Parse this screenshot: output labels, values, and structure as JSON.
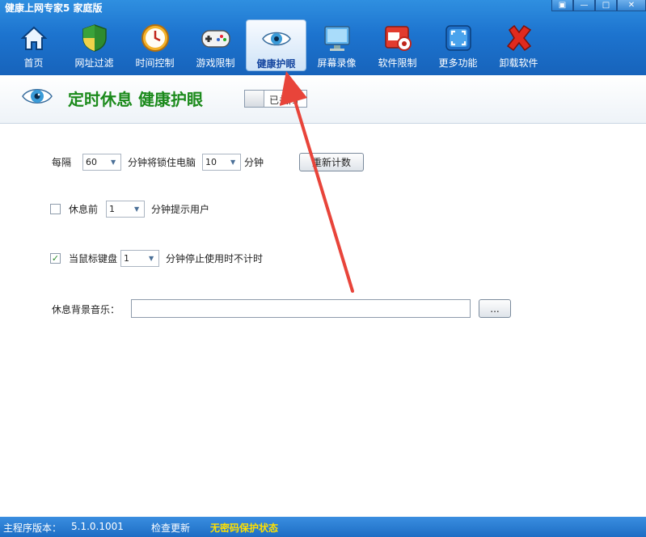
{
  "window": {
    "title": "健康上网专家5 家庭版",
    "controls": {
      "menu": "▣",
      "minimize": "—",
      "maximize": "□",
      "close": "✕"
    }
  },
  "nav": {
    "items": [
      {
        "label": "首页",
        "icon": "home-icon"
      },
      {
        "label": "网址过滤",
        "icon": "shield-icon"
      },
      {
        "label": "时间控制",
        "icon": "clock-icon"
      },
      {
        "label": "游戏限制",
        "icon": "gamepad-icon"
      },
      {
        "label": "健康护眼",
        "icon": "eye-icon",
        "active": true
      },
      {
        "label": "屏幕录像",
        "icon": "monitor-icon"
      },
      {
        "label": "软件限制",
        "icon": "software-icon"
      },
      {
        "label": "更多功能",
        "icon": "more-icon"
      },
      {
        "label": "卸载软件",
        "icon": "uninstall-icon"
      }
    ]
  },
  "header": {
    "title": "定时休息 健康护眼",
    "toggle_label": "已关闭"
  },
  "settings": {
    "every_label": "每隔",
    "interval_value": "60",
    "lock_label": "分钟将锁住电脑",
    "lock_duration_value": "10",
    "minutes_label": "分钟",
    "reset_button": "重新计数",
    "before_rest_label": "休息前",
    "before_rest_checked": false,
    "before_rest_value": "1",
    "remind_label": "分钟提示用户",
    "idle_label": "当鼠标键盘",
    "idle_checked": true,
    "idle_value": "1",
    "idle_suffix": "分钟停止使用时不计时",
    "music_label": "休息背景音乐：",
    "music_value": "",
    "browse_button": "..."
  },
  "status": {
    "version_label": "主程序版本：",
    "version_value": "5.1.0.1001",
    "check_update": "检查更新",
    "protection_state": "无密码保护状态"
  },
  "colors": {
    "topbar": "#1d74cf",
    "header_title": "#1b8a1b",
    "arrow": "#e8443a",
    "status_highlight": "#ffe000"
  }
}
